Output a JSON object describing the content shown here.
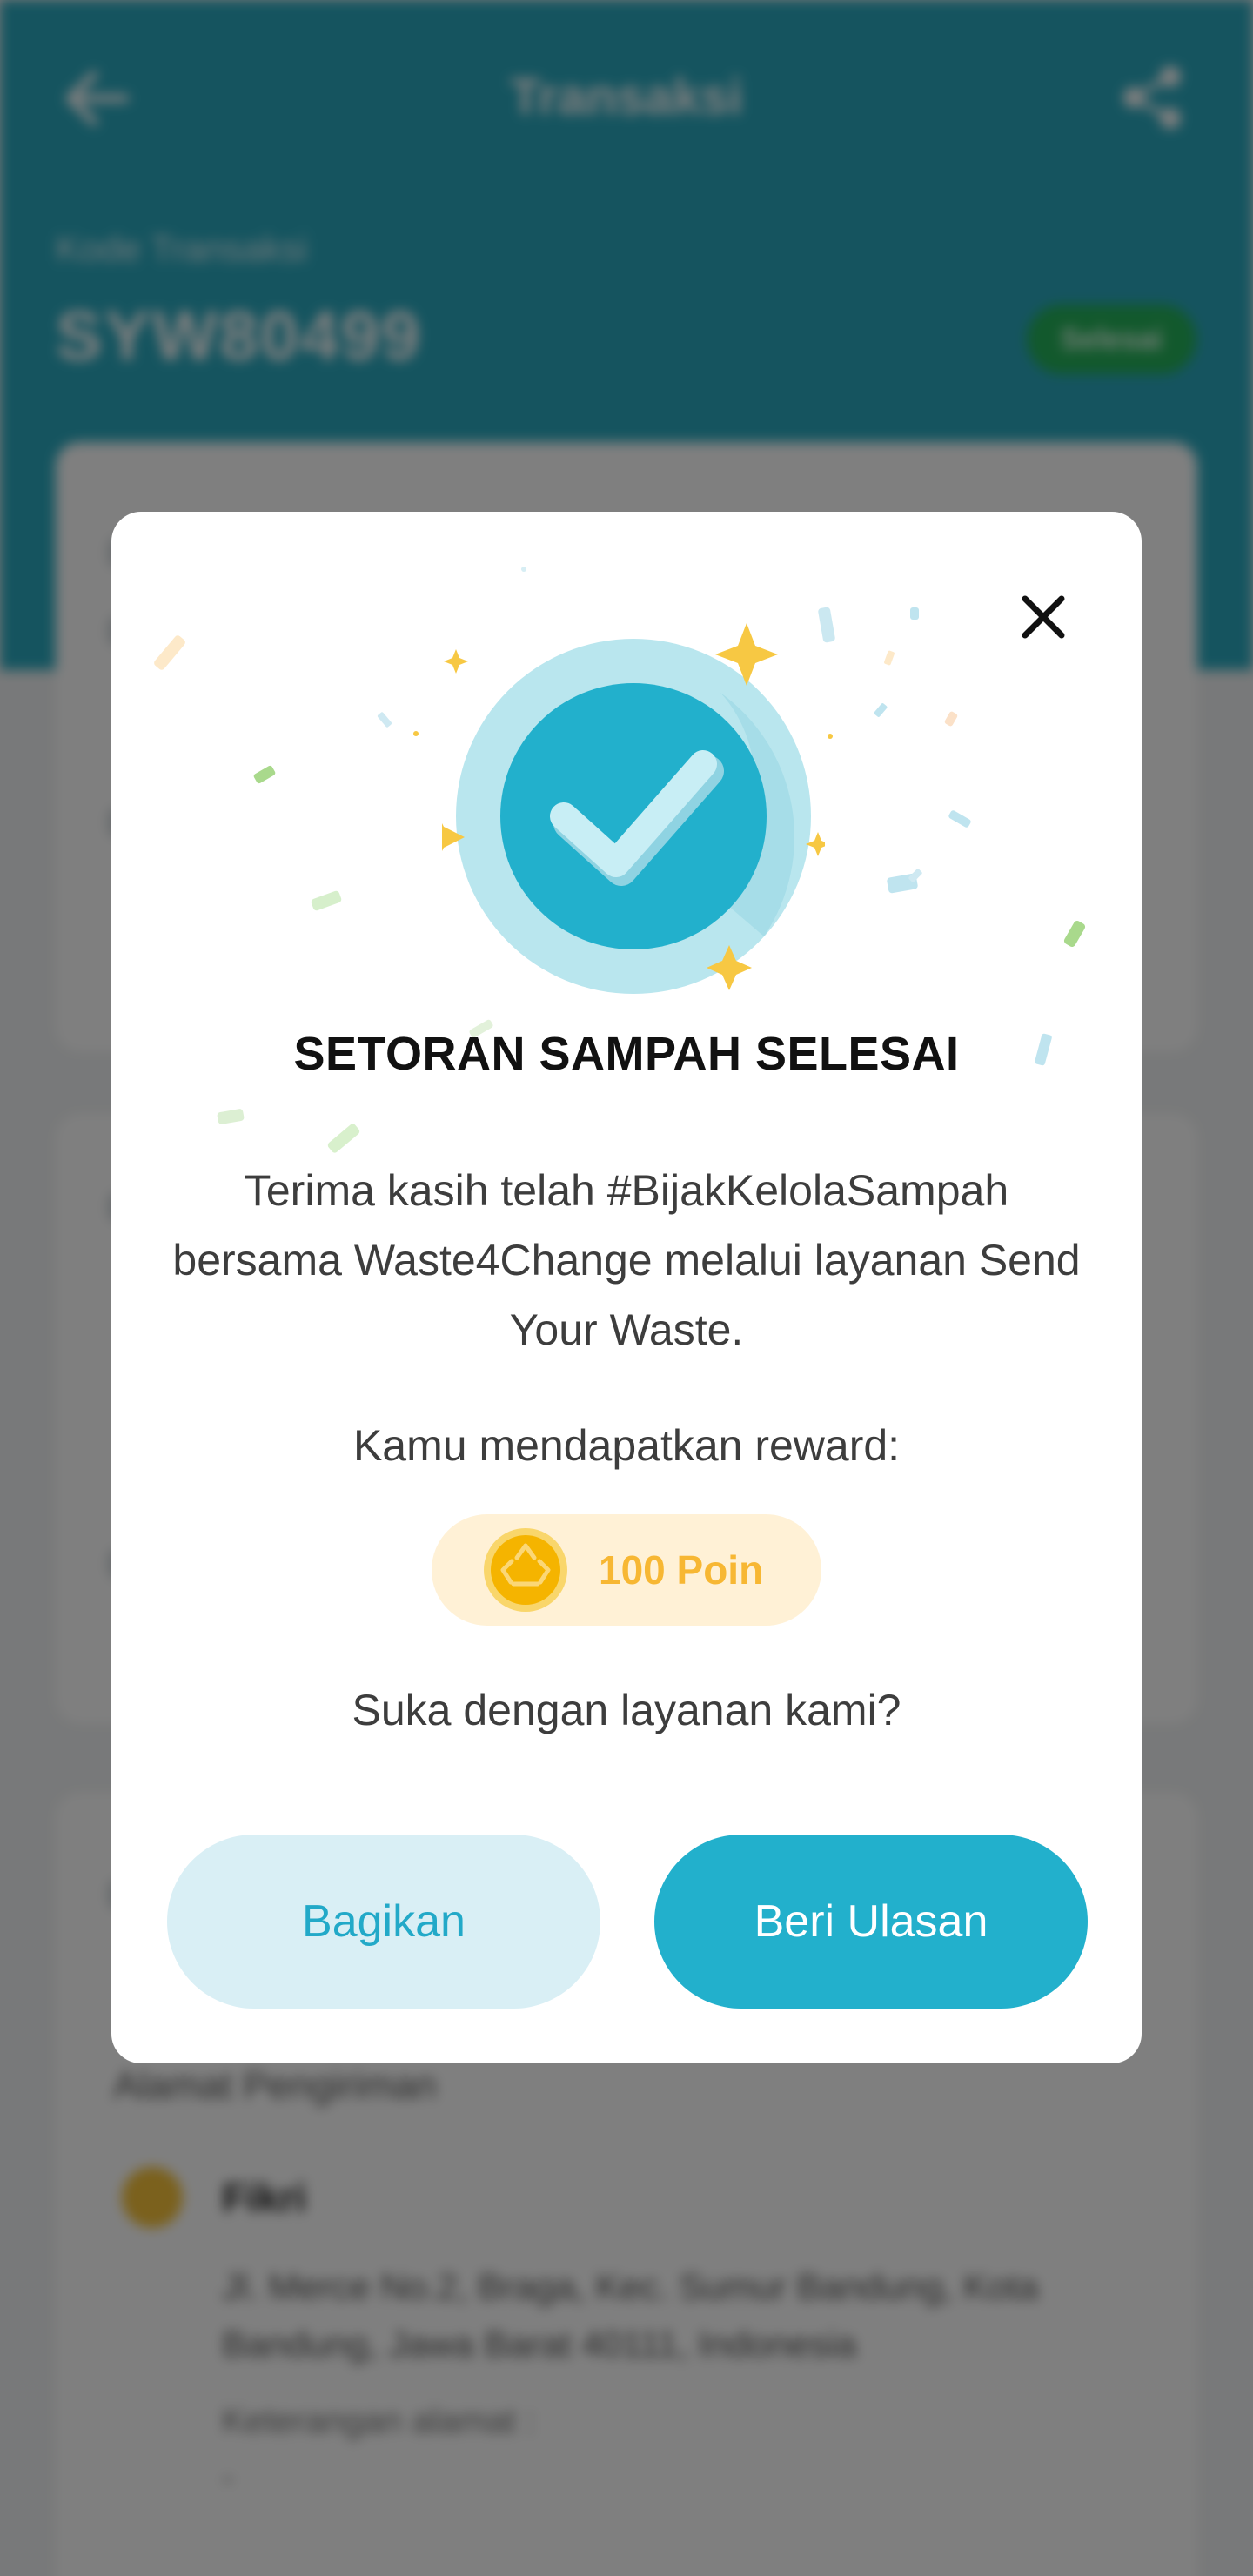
{
  "background": {
    "header": {
      "title": "Transaksi",
      "code_label": "Kode Transaksi",
      "code": "SYW80499",
      "status": "Selesai"
    },
    "address": {
      "label": "Alamat Pengiriman",
      "name": "Fikri",
      "detail": "Jl. Merce No.2, Braga, Kec. Sumur Bandung, Kota Bandung, Jawa Barat 40111, Indonesia",
      "note_label": "Keterangan alamat :",
      "note": "-"
    }
  },
  "modal": {
    "title": "SETORAN SAMPAH SELESAI",
    "message": "Terima kasih telah #BijakKelolaSampah bersama Waste4Change melalui layanan Send Your Waste.",
    "reward_label": "Kamu mendapatkan reward:",
    "reward_value": "100 Poin",
    "feedback_question": "Suka dengan layanan kami?",
    "share_button": "Bagikan",
    "review_button": "Beri Ulasan"
  },
  "colors": {
    "primary": "#22b0cc",
    "primary_light": "#d9eff5",
    "reward_bg": "#fff1d6",
    "reward_text": "#f7b733",
    "status_green": "#25b25a"
  },
  "icons": {
    "back": "arrow-left-icon",
    "share": "share-icon",
    "close": "close-icon",
    "success": "check-circle-icon",
    "coin": "recycle-coin-icon",
    "location": "location-pin-icon"
  }
}
